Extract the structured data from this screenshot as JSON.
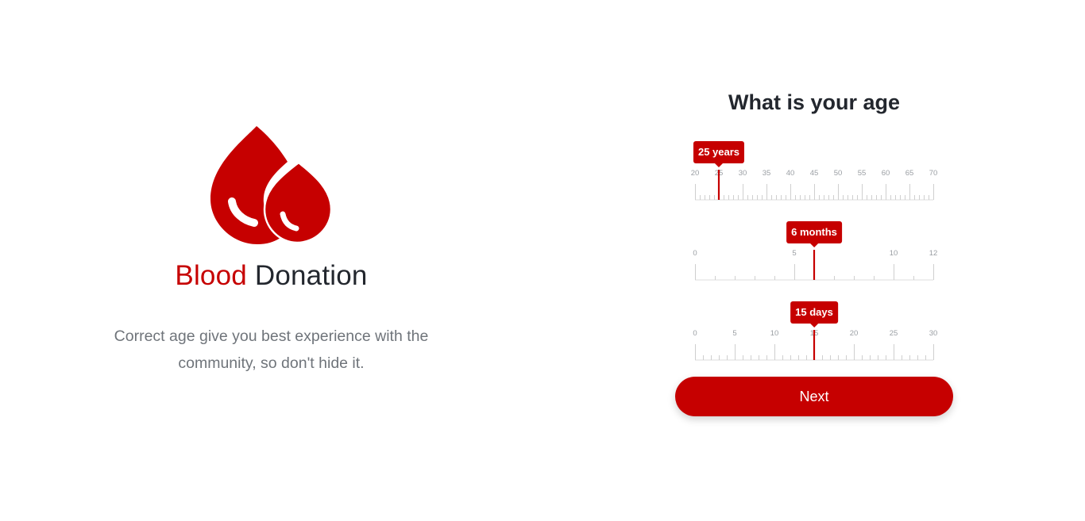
{
  "brand": {
    "word1": "Blood",
    "word2": "Donation",
    "tagline_line1": "Correct age give you best experience with the",
    "tagline_line2": "community, so don't hide it.",
    "accent_color": "#c60000",
    "logo_icon": "blood-drops-icon"
  },
  "form": {
    "question": "What is your age",
    "next_label": "Next"
  },
  "rulers": [
    {
      "name": "years-ruler",
      "min": 20,
      "max": 70,
      "major_step": 5,
      "minor_step": 1,
      "labels": [
        "20",
        "25",
        "30",
        "35",
        "40",
        "45",
        "50",
        "55",
        "60",
        "65",
        "70"
      ],
      "value": 25,
      "value_label": "25 years"
    },
    {
      "name": "months-ruler",
      "min": 0,
      "max": 12,
      "major_step": 5,
      "minor_step": 1,
      "labels": [
        "0",
        "5",
        "10",
        "12"
      ],
      "value": 6,
      "value_label": "6 months"
    },
    {
      "name": "days-ruler",
      "min": 0,
      "max": 30,
      "major_step": 5,
      "minor_step": 1,
      "labels": [
        "0",
        "5",
        "10",
        "15",
        "20",
        "25",
        "30"
      ],
      "value": 15,
      "value_label": "15 days"
    }
  ]
}
